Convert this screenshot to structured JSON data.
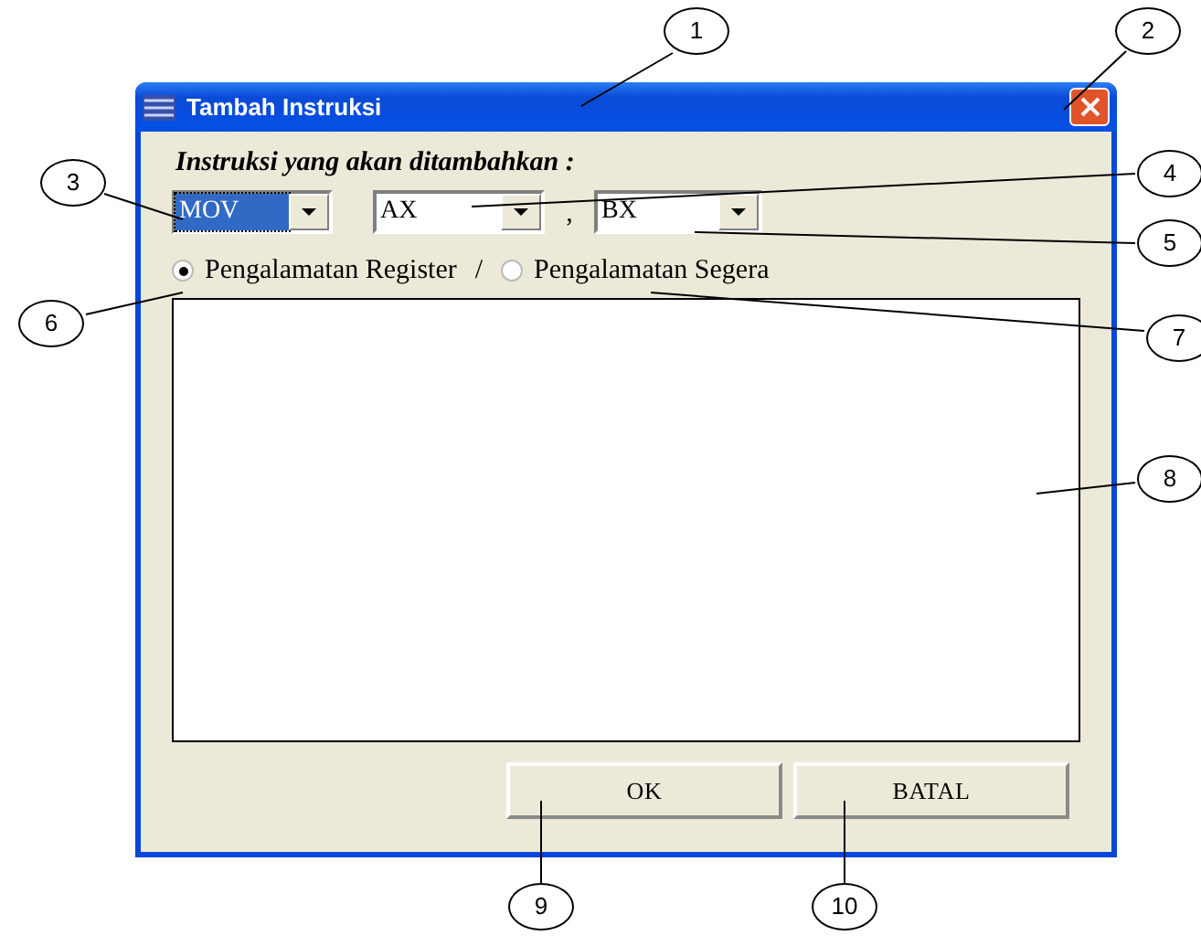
{
  "window": {
    "title": "Tambah Instruksi"
  },
  "prompt": "Instruksi yang akan ditambahkan :",
  "combos": [
    {
      "value": "MOV",
      "highlighted": true
    },
    {
      "value": "AX",
      "highlighted": false
    },
    {
      "value": "BX",
      "highlighted": false
    }
  ],
  "operand_separator": ",",
  "addressing": [
    {
      "label": "Pengalamatan Register",
      "selected": true
    },
    {
      "label": "Pengalamatan Segera",
      "selected": false
    }
  ],
  "addressing_separator": "/",
  "buttons": [
    "OK",
    "BATAL"
  ],
  "callouts": [
    "1",
    "2",
    "3",
    "4",
    "5",
    "6",
    "7",
    "8",
    "9",
    "10"
  ]
}
